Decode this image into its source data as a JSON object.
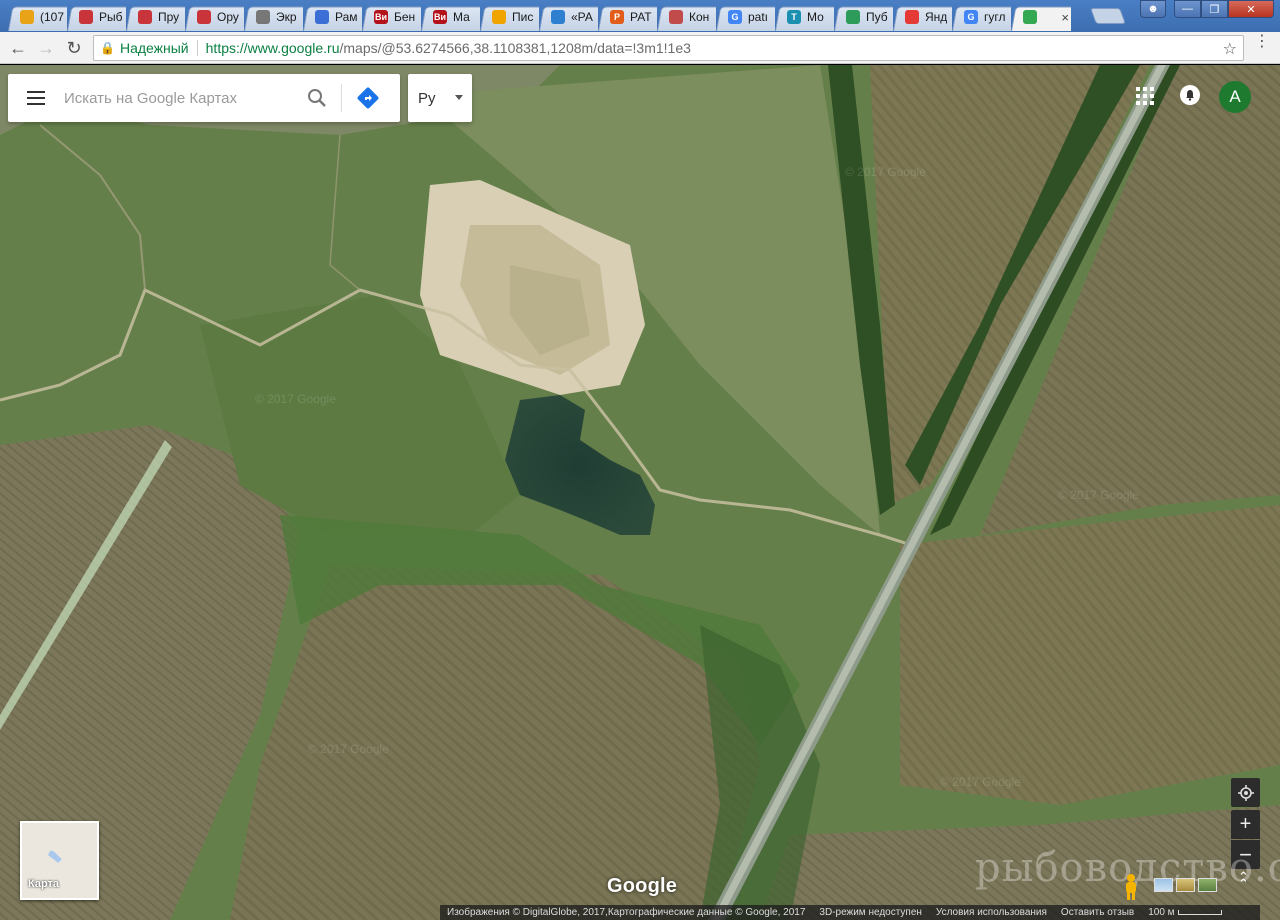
{
  "browser": {
    "tabs": [
      {
        "label": "(107",
        "icon": "at-icon",
        "color": "#e8a317"
      },
      {
        "label": "Рыб",
        "icon": "app-icon",
        "color": "#c9333a"
      },
      {
        "label": "Пру",
        "icon": "app-icon",
        "color": "#c9333a"
      },
      {
        "label": "Ору",
        "icon": "app-icon",
        "color": "#c9333a"
      },
      {
        "label": "Экр",
        "icon": "tool-icon",
        "color": "#777777"
      },
      {
        "label": "Рам",
        "icon": "mail-icon",
        "color": "#3b6fd6"
      },
      {
        "label": "Бен",
        "icon": "vi-icon",
        "color": "#b3121b",
        "text": "Ви"
      },
      {
        "label": "Ма",
        "icon": "vi-icon",
        "color": "#b3121b",
        "text": "Ви"
      },
      {
        "label": "Пис",
        "icon": "mail-icon",
        "color": "#f0a400"
      },
      {
        "label": "«РА",
        "icon": "cart-icon",
        "color": "#2f7fd1"
      },
      {
        "label": "РАТ",
        "icon": "p-icon",
        "color": "#e25c1a",
        "text": "P"
      },
      {
        "label": "Кон",
        "icon": "star-icon",
        "color": "#c14b4b"
      },
      {
        "label": "patı",
        "icon": "google-icon",
        "color": "#4285f4",
        "text": "G"
      },
      {
        "label": "Мо",
        "icon": "t-icon",
        "color": "#1b8fb0",
        "text": "T"
      },
      {
        "label": "Пуб",
        "icon": "pinwheel-icon",
        "color": "#2d9c5a"
      },
      {
        "label": "Янд",
        "icon": "map-pin-icon",
        "color": "#e53935"
      },
      {
        "label": "гугл",
        "icon": "google-icon",
        "color": "#4285f4",
        "text": "G"
      },
      {
        "label": "",
        "icon": "maps-icon",
        "color": "#34a853",
        "active": true
      }
    ],
    "secure_label": "Надежный",
    "url_host": "https://www.google.ru",
    "url_path": "/maps/@53.6274566,38.1108381,1208m/data=!3m1!1e3"
  },
  "search": {
    "placeholder": "Искать на Google Картах",
    "lang_label": "Ру"
  },
  "account": {
    "avatar_letter": "A"
  },
  "map_type": {
    "label": "Карта"
  },
  "branding": {
    "logo": "Google",
    "watermark": "рыбоводство.com"
  },
  "footer": {
    "imagery": "Изображения © DigitalGlobe, 2017,Картографические данные © Google, 2017",
    "no3d": "3D-режим недоступен",
    "terms": "Условия использования",
    "feedback": "Оставить отзыв",
    "scale": "100 м"
  },
  "colors": {
    "accent": "#1a73e8",
    "avatar_bg": "#1e7a2e",
    "secure": "#0b8043"
  }
}
